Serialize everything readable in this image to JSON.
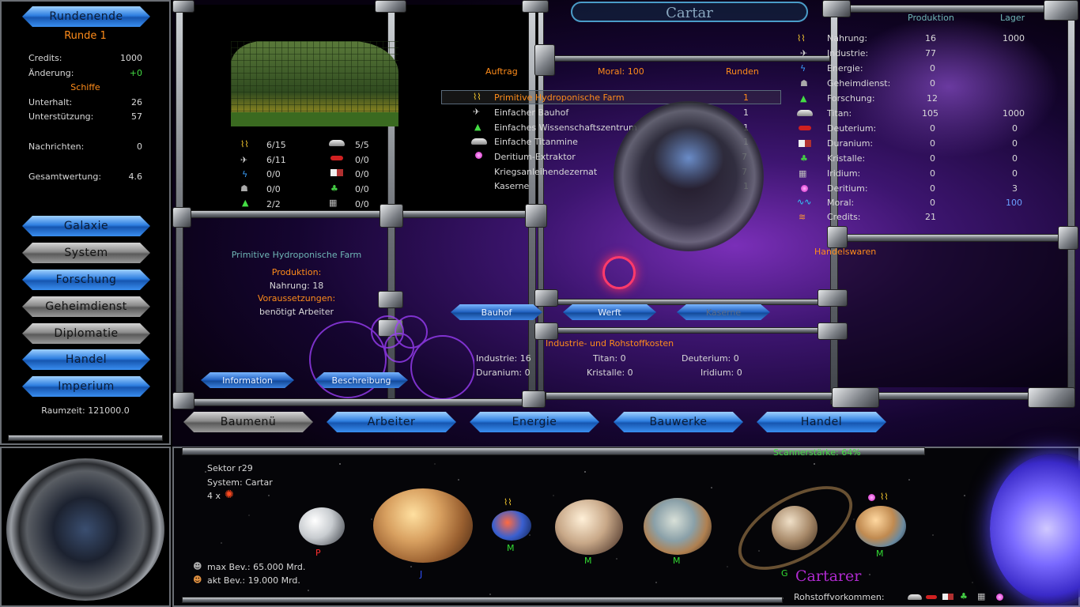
{
  "left_panel": {
    "end_turn": "Rundenende",
    "round": "Runde 1",
    "stats": [
      {
        "label": "Credits:",
        "value": "1000"
      },
      {
        "label": "Änderung:",
        "value": "+0"
      }
    ],
    "ships_header": "Schiffe",
    "ship_stats": [
      {
        "label": "Unterhalt:",
        "value": "26"
      },
      {
        "label": "Unterstützung:",
        "value": "57"
      }
    ],
    "messages": {
      "label": "Nachrichten:",
      "value": "0"
    },
    "total": {
      "label": "Gesamtwertung:",
      "value": "4.6"
    },
    "nav": [
      {
        "label": "Galaxie",
        "active": true
      },
      {
        "label": "System",
        "active": false
      },
      {
        "label": "Forschung",
        "active": true
      },
      {
        "label": "Geheimdienst",
        "active": false
      },
      {
        "label": "Diplomatie",
        "active": false
      },
      {
        "label": "Handel",
        "active": true
      },
      {
        "label": "Imperium",
        "active": true
      }
    ],
    "spacetime": "Raumzeit: 121000.0"
  },
  "system_title": "Cartar",
  "build_stats": [
    {
      "icon": "food-icon",
      "value": "6/15"
    },
    {
      "icon": "titan-icon",
      "value": "5/5"
    },
    {
      "icon": "industry-icon",
      "value": "6/11"
    },
    {
      "icon": "deuterium-icon",
      "value": "0/0"
    },
    {
      "icon": "energy-icon",
      "value": "0/0"
    },
    {
      "icon": "duranium-icon",
      "value": "0/0"
    },
    {
      "icon": "intel-icon",
      "value": "0/0"
    },
    {
      "icon": "crystal-icon",
      "value": "0/0"
    },
    {
      "icon": "research-icon",
      "value": "2/2"
    },
    {
      "icon": "iridium-icon",
      "value": "0/0"
    }
  ],
  "building_info": {
    "name": "Primitive Hydroponische Farm",
    "production_label": "Produktion:",
    "production_value": "Nahrung: 18",
    "requirements_label": "Voraussetzungen:",
    "requirements_value": "benötigt Arbeiter",
    "info_button": "Information",
    "desc_button": "Beschreibung"
  },
  "orders": {
    "col_order": "Auftrag",
    "col_moral": "Moral: 100",
    "col_rounds": "Runden",
    "items": [
      {
        "icon": "food-icon",
        "name": "Primitive Hydroponische Farm",
        "rounds": "1",
        "selected": true
      },
      {
        "icon": "industry-icon",
        "name": "Einfacher Bauhof",
        "rounds": "1",
        "selected": false
      },
      {
        "icon": "research-icon",
        "name": "Einfaches Wissenschaftszentrum",
        "rounds": "1",
        "selected": false
      },
      {
        "icon": "titan-icon",
        "name": "Einfache Titanmine",
        "rounds": "1",
        "selected": false
      },
      {
        "icon": "dilithium-icon",
        "name": "Deritium-Extraktor",
        "rounds": "7",
        "selected": false
      },
      {
        "icon": "",
        "name": "Kriegsanleihendezernat",
        "rounds": "7",
        "selected": false
      },
      {
        "icon": "",
        "name": "Kaserne",
        "rounds": "1",
        "selected": false
      }
    ]
  },
  "queue_tabs": [
    {
      "label": "Bauhof",
      "disabled": false
    },
    {
      "label": "Werft",
      "disabled": false
    },
    {
      "label": "Kaserne",
      "disabled": true
    }
  ],
  "costs": {
    "title": "Industrie- und Rohstoffkosten",
    "items": [
      "Industrie: 16",
      "Titan: 0",
      "Deuterium: 0",
      "Duranium: 0",
      "Kristalle: 0",
      "Iridium: 0"
    ]
  },
  "resources": {
    "col_production": "Produktion",
    "col_storage": "Lager",
    "rows": [
      {
        "icon": "food-icon",
        "label": "Nahrung:",
        "prod": "16",
        "store": "1000",
        "store_color": "#d8d8d8"
      },
      {
        "icon": "industry-icon",
        "label": "Industrie:",
        "prod": "77",
        "store": "",
        "store_color": "#d8d8d8"
      },
      {
        "icon": "energy-icon",
        "label": "Energie:",
        "prod": "0",
        "store": "",
        "store_color": "#d8d8d8"
      },
      {
        "icon": "intel-icon",
        "label": "Geheimdienst:",
        "prod": "0",
        "store": "",
        "store_color": "#d8d8d8"
      },
      {
        "icon": "research-icon",
        "label": "Forschung:",
        "prod": "12",
        "store": "",
        "store_color": "#d8d8d8"
      },
      {
        "icon": "titan-icon",
        "label": "Titan:",
        "prod": "105",
        "store": "1000",
        "store_color": "#d8d8d8"
      },
      {
        "icon": "deuterium-icon",
        "label": "Deuterium:",
        "prod": "0",
        "store": "0",
        "store_color": "#d8d8d8"
      },
      {
        "icon": "duranium-icon",
        "label": "Duranium:",
        "prod": "0",
        "store": "0",
        "store_color": "#d8d8d8"
      },
      {
        "icon": "crystal-icon",
        "label": "Kristalle:",
        "prod": "0",
        "store": "0",
        "store_color": "#d8d8d8"
      },
      {
        "icon": "iridium-icon",
        "label": "Iridium:",
        "prod": "0",
        "store": "0",
        "store_color": "#d8d8d8"
      },
      {
        "icon": "dilithium-icon",
        "label": "Deritium:",
        "prod": "0",
        "store": "3",
        "store_color": "#d8d8d8"
      },
      {
        "icon": "moral-icon",
        "label": "Moral:",
        "prod": "0",
        "store": "100",
        "store_color": "#6aa0ff"
      },
      {
        "icon": "credits-icon",
        "label": "Credits:",
        "prod": "21",
        "store": "",
        "store_color": "#d8d8d8"
      }
    ],
    "trade_goods": "Handelswaren"
  },
  "bottom_tabs": [
    {
      "label": "Baumenü",
      "active": false
    },
    {
      "label": "Arbeiter",
      "active": true
    },
    {
      "label": "Energie",
      "active": true
    },
    {
      "label": "Bauwerke",
      "active": true
    },
    {
      "label": "Handel",
      "active": true
    }
  ],
  "system_view": {
    "sector": "Sektor r29",
    "system": "System: Cartar",
    "fleet_count": "4 x",
    "scanner": "Scannerstärke: 64%",
    "max_pop": "max Bev.: 65.000 Mrd.",
    "cur_pop": "akt Bev.: 19.000 Mrd.",
    "race": "Cartarer",
    "resource_label": "Rohstoffvorkommen:",
    "planets": [
      {
        "class": "P",
        "color": "#ff3030"
      },
      {
        "class": "J",
        "color": "#3050ff"
      },
      {
        "class": "M",
        "color": "#33dd33"
      },
      {
        "class": "M",
        "color": "#33dd33"
      },
      {
        "class": "M",
        "color": "#33dd33"
      },
      {
        "class": "G",
        "color": "#33dd33"
      },
      {
        "class": "M",
        "color": "#33dd33"
      }
    ]
  }
}
